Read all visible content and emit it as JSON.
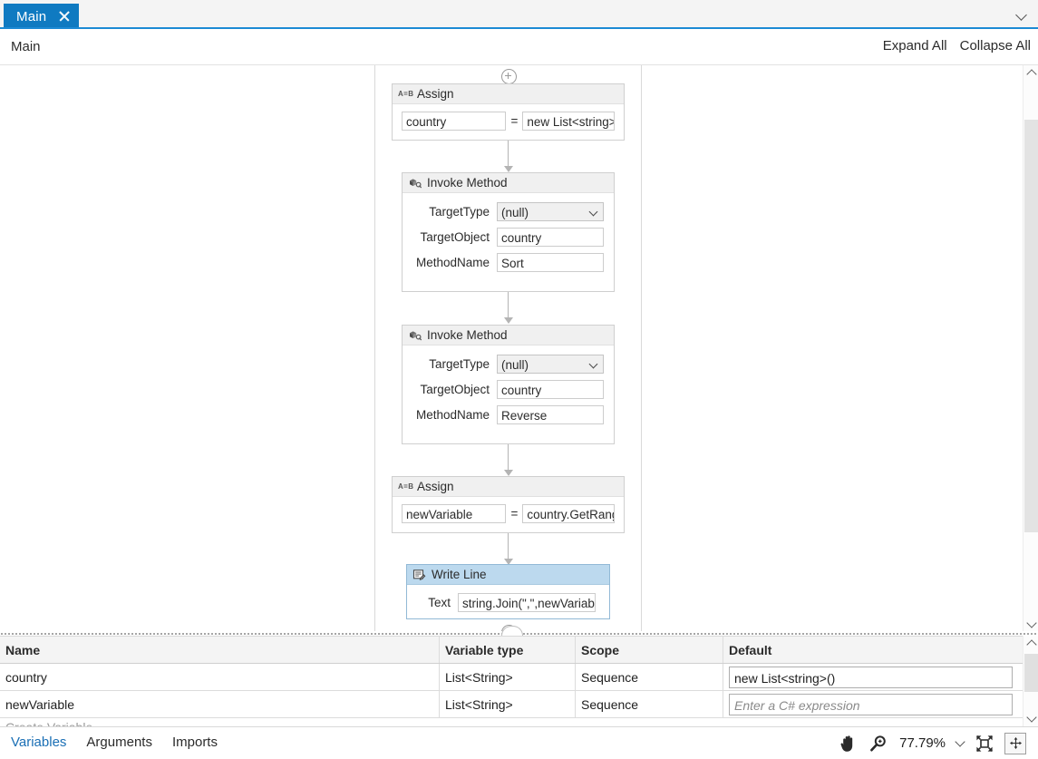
{
  "tab": {
    "label": "Main",
    "close_icon": "close-icon",
    "overflow_icon": "chevron-down-icon"
  },
  "breadcrumb": {
    "path": "Main",
    "expand_all": "Expand All",
    "collapse_all": "Collapse All"
  },
  "canvas": {
    "add_icon": "plus-circle-icon",
    "activities": [
      {
        "type": "Assign",
        "title": "Assign",
        "icon": "assign-icon",
        "icon_text": "A=B",
        "selected": false,
        "left_value": "country",
        "operator": "=",
        "right_value": "new List<string>("
      },
      {
        "type": "InvokeMethod",
        "title": "Invoke Method",
        "icon": "invoke-method-icon",
        "selected": false,
        "fields": [
          {
            "label": "TargetType",
            "value": "(null)",
            "control": "combobox"
          },
          {
            "label": "TargetObject",
            "value": "country",
            "control": "textbox"
          },
          {
            "label": "MethodName",
            "value": "Sort",
            "control": "textbox"
          }
        ]
      },
      {
        "type": "InvokeMethod",
        "title": "Invoke Method",
        "icon": "invoke-method-icon",
        "selected": false,
        "fields": [
          {
            "label": "TargetType",
            "value": "(null)",
            "control": "combobox"
          },
          {
            "label": "TargetObject",
            "value": "country",
            "control": "textbox"
          },
          {
            "label": "MethodName",
            "value": "Reverse",
            "control": "textbox"
          }
        ]
      },
      {
        "type": "Assign",
        "title": "Assign",
        "icon": "assign-icon",
        "icon_text": "A=B",
        "selected": false,
        "left_value": "newVariable",
        "operator": "=",
        "right_value": "country.GetRange"
      },
      {
        "type": "WriteLine",
        "title": "Write Line",
        "icon": "write-line-icon",
        "selected": true,
        "fields": [
          {
            "label": "Text",
            "value": "string.Join(\",\",newVariable.",
            "control": "textbox"
          }
        ]
      }
    ],
    "scrollbar": {
      "up_icon": "chevron-up-icon",
      "down_icon": "chevron-down-icon"
    }
  },
  "variables_panel": {
    "columns": [
      "Name",
      "Variable type",
      "Scope",
      "Default"
    ],
    "rows": [
      {
        "name": "country",
        "type": "List<String>",
        "scope": "Sequence",
        "default_value": "new List<string>()",
        "default_is_placeholder": false
      },
      {
        "name": "newVariable",
        "type": "List<String>",
        "scope": "Sequence",
        "default_value": "Enter a C# expression",
        "default_is_placeholder": true
      }
    ],
    "create_row_label": "Create Variable",
    "scrollbar": {
      "up_icon": "chevron-up-icon",
      "down_icon": "chevron-down-icon"
    }
  },
  "statusbar": {
    "tabs": [
      {
        "label": "Variables",
        "active": true
      },
      {
        "label": "Arguments",
        "active": false
      },
      {
        "label": "Imports",
        "active": false
      }
    ],
    "pan_icon": "hand-pan-icon",
    "zoom_icon": "magnifier-plus-icon",
    "zoom_level": "77.79%",
    "zoom_dropdown_icon": "chevron-down-icon",
    "fit_screen_icon": "fit-to-screen-icon",
    "fit_size_icon": "fit-to-size-icon"
  },
  "colors": {
    "tab_active": "#0f7ac1",
    "accent_underline": "#1c8ad4",
    "selected_activity_header": "#bcd9ee",
    "link_text": "#1a6fb5"
  }
}
